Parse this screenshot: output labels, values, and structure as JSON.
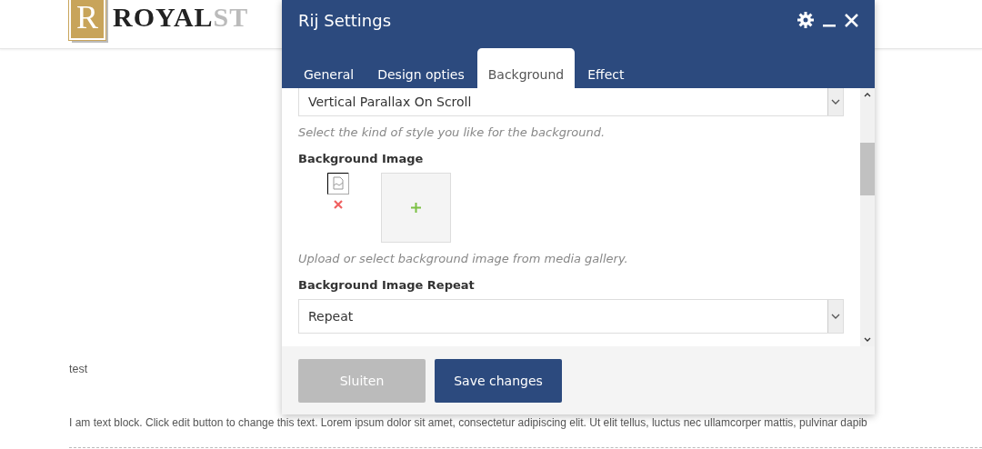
{
  "page": {
    "logo": {
      "letter": "R",
      "primary": "ROYAL",
      "secondary": "ST"
    },
    "texts": [
      "test",
      "I am text block. Click edit button to change this text. Lorem ipsum dolor sit amet, consectetur adipiscing elit. Ut elit tellus, luctus nec ullamcorper mattis, pulvinar dapib"
    ]
  },
  "dialog": {
    "title": "Rij Settings",
    "tabs": [
      {
        "label": "General",
        "selected": false
      },
      {
        "label": "Design opties",
        "selected": false
      },
      {
        "label": "Background",
        "selected": true
      },
      {
        "label": "Effect",
        "selected": false
      }
    ],
    "fields": [
      {
        "kind": "select",
        "value": "Vertical Parallax On Scroll",
        "hint": "Select the kind of style you like for the background."
      },
      {
        "kind": "image",
        "label": "Background Image",
        "hint": "Upload or select background image from media gallery."
      },
      {
        "kind": "select",
        "label": "Background Image Repeat",
        "value": "Repeat"
      }
    ],
    "buttons": [
      {
        "label": "Sluiten",
        "kind": "secondary"
      },
      {
        "label": "Save changes",
        "kind": "primary"
      }
    ]
  }
}
